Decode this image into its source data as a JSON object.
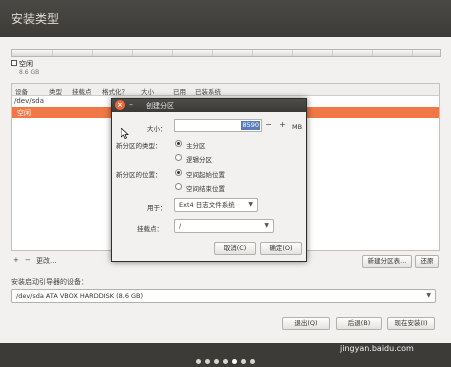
{
  "window": {
    "title": "安装类型"
  },
  "disk_bar": {
    "free_label": "空闲",
    "free_size": "8.6 GB"
  },
  "table": {
    "columns": [
      "设备",
      "类型",
      "挂载点",
      "格式化？",
      "大小",
      "已用",
      "已装系统"
    ],
    "rows": [
      {
        "device": "/dev/sda"
      },
      {
        "device": "空闲"
      }
    ]
  },
  "table_actions": {
    "add": "+",
    "remove": "−",
    "change": "更改..."
  },
  "right_buttons": {
    "new_table": "新建分区表...",
    "revert": "还原"
  },
  "boot": {
    "label": "安装启动引导器的设备：",
    "selected": "/dev/sda ATA VBOX HARDDISK (8.6 GB)"
  },
  "nav": {
    "quit": "退出(Q)",
    "back": "后退(B)",
    "install": "现在安装(I)"
  },
  "dialog": {
    "title": "创建分区",
    "size_label": "大小：",
    "size_value": "8590",
    "size_unit": "MB",
    "minus": "−",
    "plus": "+",
    "type_label": "新分区的类型：",
    "type_options": [
      "主分区",
      "逻辑分区"
    ],
    "type_selected": 0,
    "location_label": "新分区的位置：",
    "location_options": [
      "空间起始位置",
      "空间结束位置"
    ],
    "location_selected": 0,
    "use_label": "用于：",
    "use_value": "Ext4 日志文件系统",
    "mount_label": "挂载点：",
    "mount_value": "/",
    "cancel": "取消(C)",
    "ok": "确定(O)"
  },
  "progress_dots": {
    "total": 7,
    "current": 4
  },
  "watermark": "jingyan.baidu.com",
  "colors": {
    "accent": "#f07746",
    "selection": "#5a7db8",
    "titlebar": "#3c3b37"
  }
}
